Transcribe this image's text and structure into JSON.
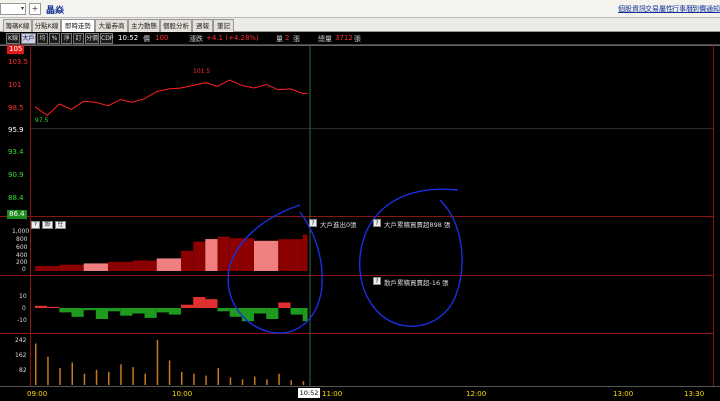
{
  "topbar": {
    "stock_name": "晶焱",
    "links": [
      "個股資訊",
      "交易屬性",
      "行事曆",
      "到價通知"
    ]
  },
  "tabs": [
    "籌碼K線",
    "分點K線",
    "即時走勢",
    "大量券商",
    "主力動態",
    "個股分析",
    "週報",
    "筆記"
  ],
  "active_tab": "即時走勢",
  "infobar": {
    "buttons": [
      "K線",
      "大戶",
      "均",
      "%",
      "淨",
      "訂",
      "分價",
      "CDP"
    ],
    "active_buttons": [
      "大戶"
    ],
    "time": "10:52",
    "price_label": "價",
    "price_value": "100",
    "change_label": "漲跌",
    "change_value": "+4.1 (+4.28%)",
    "volume_label": "量",
    "volume_value": "2",
    "volume_unit": "張",
    "total_label": "總量",
    "total_value": "3712",
    "total_unit": "張"
  },
  "price_panel": {
    "y_labels": [
      "105",
      "103.5",
      "101",
      "98.5",
      "95.9",
      "93.4",
      "90.9",
      "88.4",
      "86.4"
    ],
    "high_label": "101.5",
    "low_label": "97.5"
  },
  "large_holder_panel": {
    "controls": [
      "?",
      "設",
      "任"
    ],
    "y_labels": [
      "1,000",
      "800",
      "600",
      "400",
      "200",
      "0"
    ],
    "net_label": "大戶進出0張",
    "cumulative_label": "大戶累積買賣超898 張"
  },
  "retail_panel": {
    "y_labels": [
      "10",
      "0",
      "-10"
    ],
    "cumulative_label": "散戶累積買賣超-16 張"
  },
  "volume_panel": {
    "y_labels": [
      "242",
      "162",
      "82"
    ]
  },
  "time_axis": {
    "labels": [
      "09:00",
      "10:00",
      "11:00",
      "12:00",
      "13:00",
      "13:30"
    ],
    "cursor_time": "10:52"
  },
  "chart_data": {
    "type": "line",
    "x_range": [
      "09:00",
      "13:30"
    ],
    "price": {
      "ylim": [
        86.4,
        105
      ],
      "reference": 95.9,
      "x": [
        "09:00",
        "09:05",
        "09:10",
        "09:15",
        "09:20",
        "09:25",
        "09:30",
        "09:35",
        "09:40",
        "09:45",
        "09:50",
        "09:55",
        "10:00",
        "10:05",
        "10:10",
        "10:15",
        "10:20",
        "10:25",
        "10:30",
        "10:35",
        "10:40",
        "10:45",
        "10:50",
        "10:52"
      ],
      "values": [
        98.5,
        97.5,
        98.8,
        98.2,
        99.1,
        99.0,
        98.6,
        99.3,
        99.0,
        99.4,
        100.2,
        100.5,
        100.6,
        100.9,
        101.2,
        100.8,
        101.5,
        100.9,
        100.6,
        101.0,
        100.4,
        100.5,
        100.0,
        100.0
      ],
      "high": 101.5,
      "low": 97.5
    },
    "large_holder": {
      "ylim": [
        0,
        1000
      ],
      "x": [
        "09:00",
        "09:10",
        "09:20",
        "09:30",
        "09:40",
        "09:50",
        "10:00",
        "10:05",
        "10:10",
        "10:15",
        "10:20",
        "10:30",
        "10:40",
        "10:50",
        "10:52"
      ],
      "values": [
        120,
        150,
        180,
        220,
        250,
        300,
        480,
        700,
        760,
        820,
        780,
        720,
        760,
        870,
        898
      ],
      "cumulative": 898
    },
    "retail": {
      "ylim": [
        -15,
        15
      ],
      "x": [
        "09:00",
        "09:05",
        "09:10",
        "09:15",
        "09:20",
        "09:25",
        "09:30",
        "09:35",
        "09:40",
        "09:45",
        "09:50",
        "09:55",
        "10:00",
        "10:05",
        "10:10",
        "10:15",
        "10:20",
        "10:25",
        "10:30",
        "10:35",
        "10:40",
        "10:45",
        "10:50",
        "10:52"
      ],
      "values": [
        2,
        1,
        -4,
        -8,
        -2,
        -10,
        -3,
        -7,
        -5,
        -9,
        -4,
        -6,
        3,
        10,
        8,
        -3,
        -8,
        -12,
        -5,
        -10,
        5,
        -6,
        -12,
        -16
      ],
      "cumulative": -16
    },
    "volume": {
      "ylim": [
        0,
        260
      ],
      "x": [
        "09:00",
        "09:05",
        "09:10",
        "09:15",
        "09:20",
        "09:25",
        "09:30",
        "09:35",
        "09:40",
        "09:45",
        "09:50",
        "09:55",
        "10:00",
        "10:05",
        "10:10",
        "10:15",
        "10:20",
        "10:25",
        "10:30",
        "10:35",
        "10:40",
        "10:45",
        "10:50"
      ],
      "values": [
        220,
        150,
        90,
        120,
        60,
        80,
        70,
        110,
        95,
        60,
        240,
        130,
        70,
        60,
        50,
        90,
        40,
        30,
        45,
        30,
        60,
        25,
        20
      ]
    },
    "colors": {
      "price_line": "#ff2020",
      "large_holder_fill": "#8b0000",
      "large_holder_light": "#f08080",
      "retail_positive": "#e23030",
      "retail_negative": "#1e9a1e",
      "volume_bar": "#c87820",
      "cursor_line": "#2d6b4a"
    }
  }
}
